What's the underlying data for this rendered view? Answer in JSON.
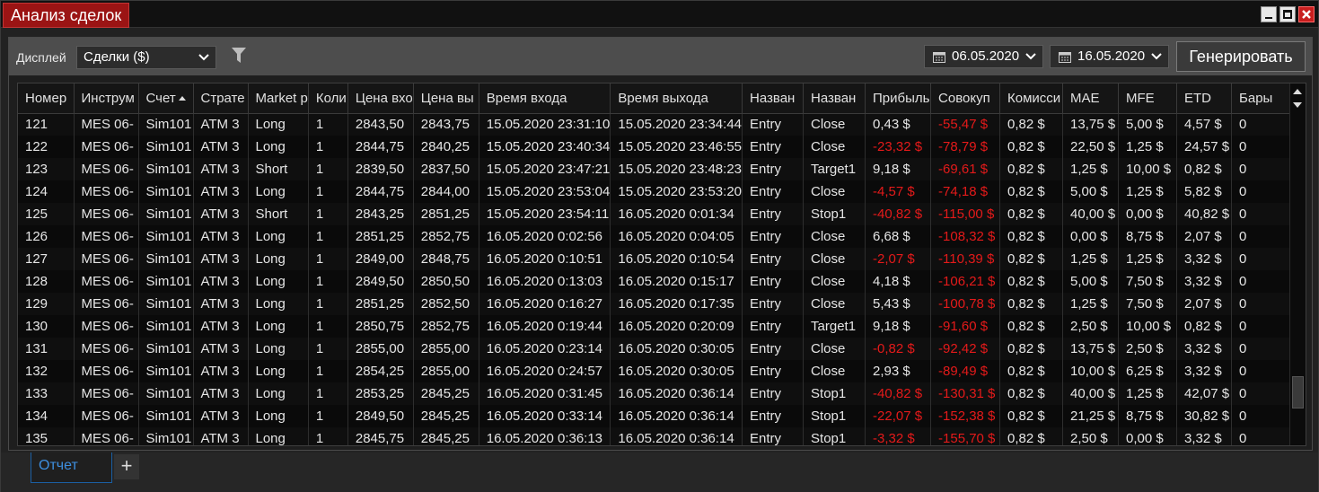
{
  "window": {
    "title": "Анализ сделок"
  },
  "toolbar": {
    "display_label": "Дисплей",
    "display_value": "Сделки ($)",
    "date_from": "06.05.2020",
    "date_to": "16.05.2020",
    "generate_label": "Генерировать"
  },
  "columns": [
    "Номер",
    "Инструм",
    "Счет",
    "Страте",
    "Market p",
    "Коли",
    "Цена вхо",
    "Цена вы",
    "Время входа",
    "Время выхода",
    "Назван",
    "Назван",
    "Прибыль",
    "Совокуп",
    "Комисси",
    "MAE",
    "MFE",
    "ETD",
    "Бары"
  ],
  "rows": [
    [
      "121",
      "MES 06-",
      "Sim101",
      "ATM 3",
      "Long",
      "1",
      "2843,50",
      "2843,75",
      "15.05.2020 23:31:10",
      "15.05.2020 23:34:44",
      "Entry",
      "Close",
      "0,43 $",
      "-55,47 $",
      "0,82 $",
      "13,75 $",
      "5,00 $",
      "4,57 $",
      "0"
    ],
    [
      "122",
      "MES 06-",
      "Sim101",
      "ATM 3",
      "Long",
      "1",
      "2844,75",
      "2840,25",
      "15.05.2020 23:40:34",
      "15.05.2020 23:46:55",
      "Entry",
      "Close",
      "-23,32 $",
      "-78,79 $",
      "0,82 $",
      "22,50 $",
      "1,25 $",
      "24,57 $",
      "0"
    ],
    [
      "123",
      "MES 06-",
      "Sim101",
      "ATM 3",
      "Short",
      "1",
      "2839,50",
      "2837,50",
      "15.05.2020 23:47:21",
      "15.05.2020 23:48:23",
      "Entry",
      "Target1",
      "9,18 $",
      "-69,61 $",
      "0,82 $",
      "1,25 $",
      "10,00 $",
      "0,82 $",
      "0"
    ],
    [
      "124",
      "MES 06-",
      "Sim101",
      "ATM 3",
      "Long",
      "1",
      "2844,75",
      "2844,00",
      "15.05.2020 23:53:04",
      "15.05.2020 23:53:20",
      "Entry",
      "Close",
      "-4,57 $",
      "-74,18 $",
      "0,82 $",
      "5,00 $",
      "1,25 $",
      "5,82 $",
      "0"
    ],
    [
      "125",
      "MES 06-",
      "Sim101",
      "ATM 3",
      "Short",
      "1",
      "2843,25",
      "2851,25",
      "15.05.2020 23:54:11",
      "16.05.2020 0:01:34",
      "Entry",
      "Stop1",
      "-40,82 $",
      "-115,00 $",
      "0,82 $",
      "40,00 $",
      "0,00 $",
      "40,82 $",
      "0"
    ],
    [
      "126",
      "MES 06-",
      "Sim101",
      "ATM 3",
      "Long",
      "1",
      "2851,25",
      "2852,75",
      "16.05.2020 0:02:56",
      "16.05.2020 0:04:05",
      "Entry",
      "Close",
      "6,68 $",
      "-108,32 $",
      "0,82 $",
      "0,00 $",
      "8,75 $",
      "2,07 $",
      "0"
    ],
    [
      "127",
      "MES 06-",
      "Sim101",
      "ATM 3",
      "Long",
      "1",
      "2849,00",
      "2848,75",
      "16.05.2020 0:10:51",
      "16.05.2020 0:10:54",
      "Entry",
      "Close",
      "-2,07 $",
      "-110,39 $",
      "0,82 $",
      "1,25 $",
      "1,25 $",
      "3,32 $",
      "0"
    ],
    [
      "128",
      "MES 06-",
      "Sim101",
      "ATM 3",
      "Long",
      "1",
      "2849,50",
      "2850,50",
      "16.05.2020 0:13:03",
      "16.05.2020 0:15:17",
      "Entry",
      "Close",
      "4,18 $",
      "-106,21 $",
      "0,82 $",
      "5,00 $",
      "7,50 $",
      "3,32 $",
      "0"
    ],
    [
      "129",
      "MES 06-",
      "Sim101",
      "ATM 3",
      "Long",
      "1",
      "2851,25",
      "2852,50",
      "16.05.2020 0:16:27",
      "16.05.2020 0:17:35",
      "Entry",
      "Close",
      "5,43 $",
      "-100,78 $",
      "0,82 $",
      "1,25 $",
      "7,50 $",
      "2,07 $",
      "0"
    ],
    [
      "130",
      "MES 06-",
      "Sim101",
      "ATM 3",
      "Long",
      "1",
      "2850,75",
      "2852,75",
      "16.05.2020 0:19:44",
      "16.05.2020 0:20:09",
      "Entry",
      "Target1",
      "9,18 $",
      "-91,60 $",
      "0,82 $",
      "2,50 $",
      "10,00 $",
      "0,82 $",
      "0"
    ],
    [
      "131",
      "MES 06-",
      "Sim101",
      "ATM 3",
      "Long",
      "1",
      "2855,00",
      "2855,00",
      "16.05.2020 0:23:14",
      "16.05.2020 0:30:05",
      "Entry",
      "Close",
      "-0,82 $",
      "-92,42 $",
      "0,82 $",
      "13,75 $",
      "2,50 $",
      "3,32 $",
      "0"
    ],
    [
      "132",
      "MES 06-",
      "Sim101",
      "ATM 3",
      "Long",
      "1",
      "2854,25",
      "2855,00",
      "16.05.2020 0:24:57",
      "16.05.2020 0:30:05",
      "Entry",
      "Close",
      "2,93 $",
      "-89,49 $",
      "0,82 $",
      "10,00 $",
      "6,25 $",
      "3,32 $",
      "0"
    ],
    [
      "133",
      "MES 06-",
      "Sim101",
      "ATM 3",
      "Long",
      "1",
      "2853,25",
      "2845,25",
      "16.05.2020 0:31:45",
      "16.05.2020 0:36:14",
      "Entry",
      "Stop1",
      "-40,82 $",
      "-130,31 $",
      "0,82 $",
      "40,00 $",
      "1,25 $",
      "42,07 $",
      "0"
    ],
    [
      "134",
      "MES 06-",
      "Sim101",
      "ATM 3",
      "Long",
      "1",
      "2849,50",
      "2845,25",
      "16.05.2020 0:33:14",
      "16.05.2020 0:36:14",
      "Entry",
      "Stop1",
      "-22,07 $",
      "-152,38 $",
      "0,82 $",
      "21,25 $",
      "8,75 $",
      "30,82 $",
      "0"
    ],
    [
      "135",
      "MES 06-",
      "Sim101",
      "ATM 3",
      "Long",
      "1",
      "2845,75",
      "2845,25",
      "16.05.2020 0:36:13",
      "16.05.2020 0:36:14",
      "Entry",
      "Stop1",
      "-3,32 $",
      "-155,70 $",
      "0,82 $",
      "2,50 $",
      "0,00 $",
      "3,32 $",
      "0"
    ]
  ],
  "tabs": [
    {
      "label": "Отчет"
    }
  ],
  "add_tab_label": "+",
  "colors": {
    "negative": "#e41a1a",
    "accent": "#9b1414",
    "tab_active": "#3d8fe0"
  },
  "icons": {
    "filter": "filter-icon",
    "calendar": "calendar-icon",
    "sort": "sort-ascending-icon"
  }
}
